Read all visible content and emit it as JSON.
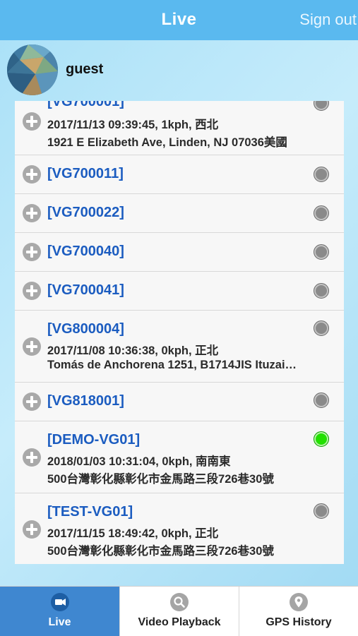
{
  "header": {
    "title": "Live",
    "signout_label": "Sign out"
  },
  "user": {
    "name": "guest"
  },
  "devices": [
    {
      "name": "[VG700001]",
      "line1": "2017/11/13 09:39:45, 1kph, 西北",
      "line2": "1921 E Elizabeth Ave, Linden, NJ 07036美國",
      "online": false
    },
    {
      "name": "[VG700011]",
      "line1": "",
      "line2": "",
      "online": false
    },
    {
      "name": "[VG700022]",
      "line1": "",
      "line2": "",
      "online": false
    },
    {
      "name": "[VG700040]",
      "line1": "",
      "line2": "",
      "online": false
    },
    {
      "name": "[VG700041]",
      "line1": "",
      "line2": "",
      "online": false
    },
    {
      "name": "[VG800004]",
      "line1": "2017/11/08 10:36:38, 0kph, 正北",
      "line2": "Tomás de Anchorena 1251, B1714JIS Ituzai…",
      "online": false
    },
    {
      "name": "[VG818001]",
      "line1": "",
      "line2": "",
      "online": false
    },
    {
      "name": "[DEMO-VG01]",
      "line1": "2018/01/03 10:31:04, 0kph, 南南東",
      "line2": "500台灣彰化縣彰化市金馬路三段726巷30號",
      "online": true
    },
    {
      "name": "[TEST-VG01]",
      "line1": "2017/11/15 18:49:42, 0kph, 正北",
      "line2": "500台灣彰化縣彰化市金馬路三段726巷30號",
      "online": false
    }
  ],
  "tabs": [
    {
      "label": "Live",
      "icon": "video-camera-icon",
      "active": true
    },
    {
      "label": "Video Playback",
      "icon": "magnifier-icon",
      "active": false
    },
    {
      "label": "GPS History",
      "icon": "map-pin-icon",
      "active": false
    }
  ],
  "colors": {
    "header": "#5ab9ef",
    "device_name": "#1b5cc0",
    "online": "#22e000",
    "offline": "#8a8a8a",
    "active_tab": "#3f87d0"
  }
}
